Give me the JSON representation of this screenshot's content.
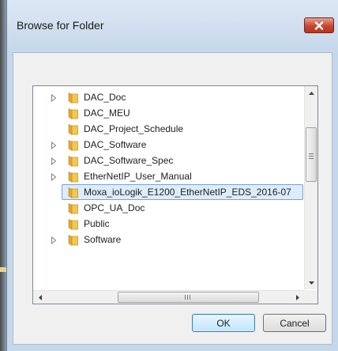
{
  "window": {
    "title": "Browse for Folder",
    "close_icon": "close-x-icon"
  },
  "tree": {
    "items": [
      {
        "label": "DAC_Doc",
        "expandable": true,
        "selected": false
      },
      {
        "label": "DAC_MEU",
        "expandable": false,
        "selected": false
      },
      {
        "label": "DAC_Project_Schedule",
        "expandable": false,
        "selected": false
      },
      {
        "label": "DAC_Software",
        "expandable": true,
        "selected": false
      },
      {
        "label": "DAC_Software_Spec",
        "expandable": true,
        "selected": false
      },
      {
        "label": "EtherNetIP_User_Manual",
        "expandable": true,
        "selected": false
      },
      {
        "label": "Moxa_ioLogik_E1200_EtherNetIP_EDS_2016-07",
        "expandable": false,
        "selected": true
      },
      {
        "label": "OPC_UA_Doc",
        "expandable": false,
        "selected": false
      },
      {
        "label": "Public",
        "expandable": false,
        "selected": false
      },
      {
        "label": "Software",
        "expandable": true,
        "selected": false
      }
    ],
    "folder_icon": "folder-icon",
    "vertical_scroll": {
      "position": 0.31,
      "visible_fraction": 0.31
    },
    "horizontal_scroll": {
      "position": 0.29,
      "visible_fraction": 0.58
    }
  },
  "buttons": {
    "ok_label": "OK",
    "cancel_label": "Cancel"
  },
  "colors": {
    "selection_fill": "#dcecfc",
    "selection_border": "#7da2ce",
    "close_button": "#c7472f",
    "folder": "#e9b941"
  }
}
